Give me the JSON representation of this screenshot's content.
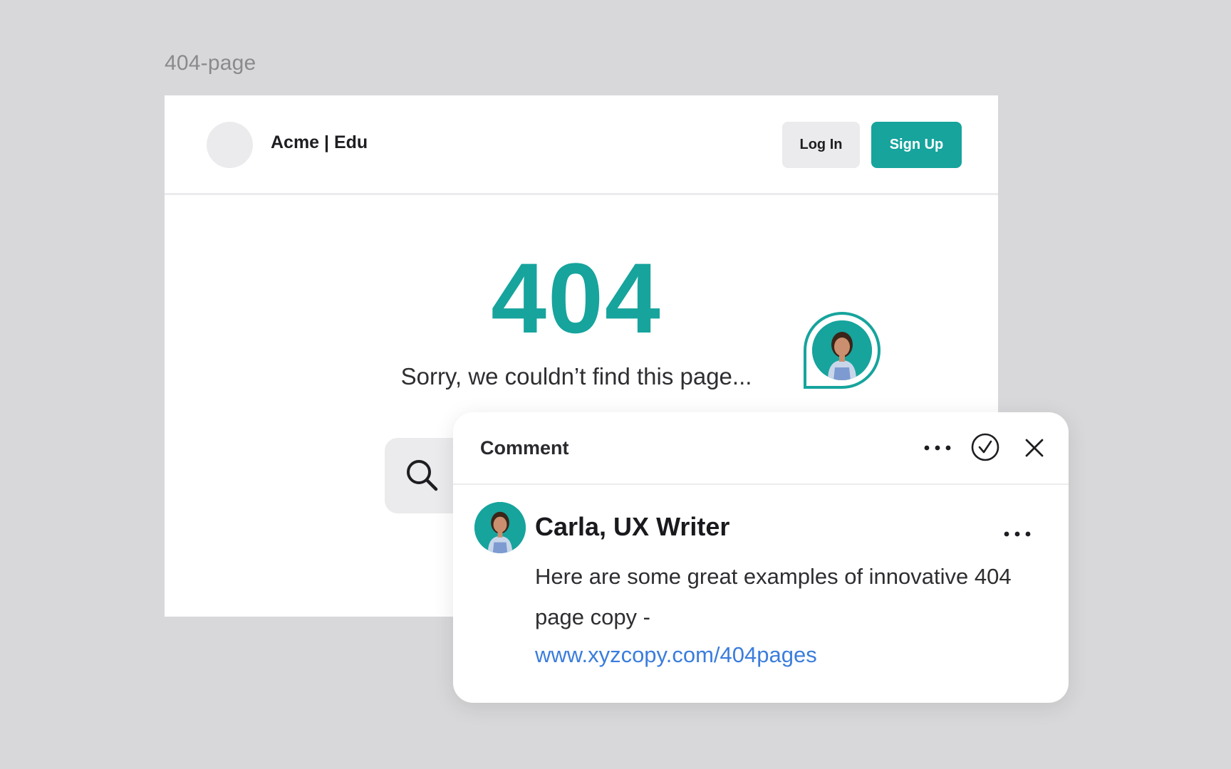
{
  "frame": {
    "label": "404-page"
  },
  "navbar": {
    "brand": "Acme | Edu",
    "login_label": "Log In",
    "signup_label": "Sign Up"
  },
  "error": {
    "code": "404",
    "message": "Sorry, we couldn’t find this page..."
  },
  "comment_panel": {
    "title": "Comment",
    "author": "Carla, UX Writer",
    "body": "Here are some great examples of innovative 404 page copy -",
    "link": "www.xyzcopy.com/404pages"
  },
  "colors": {
    "accent": "#16a49d",
    "link": "#3b7ddd",
    "canvas": "#d8d8da"
  },
  "icons": [
    "search-icon",
    "more-icon",
    "resolve-check-icon",
    "close-icon",
    "avatar"
  ]
}
